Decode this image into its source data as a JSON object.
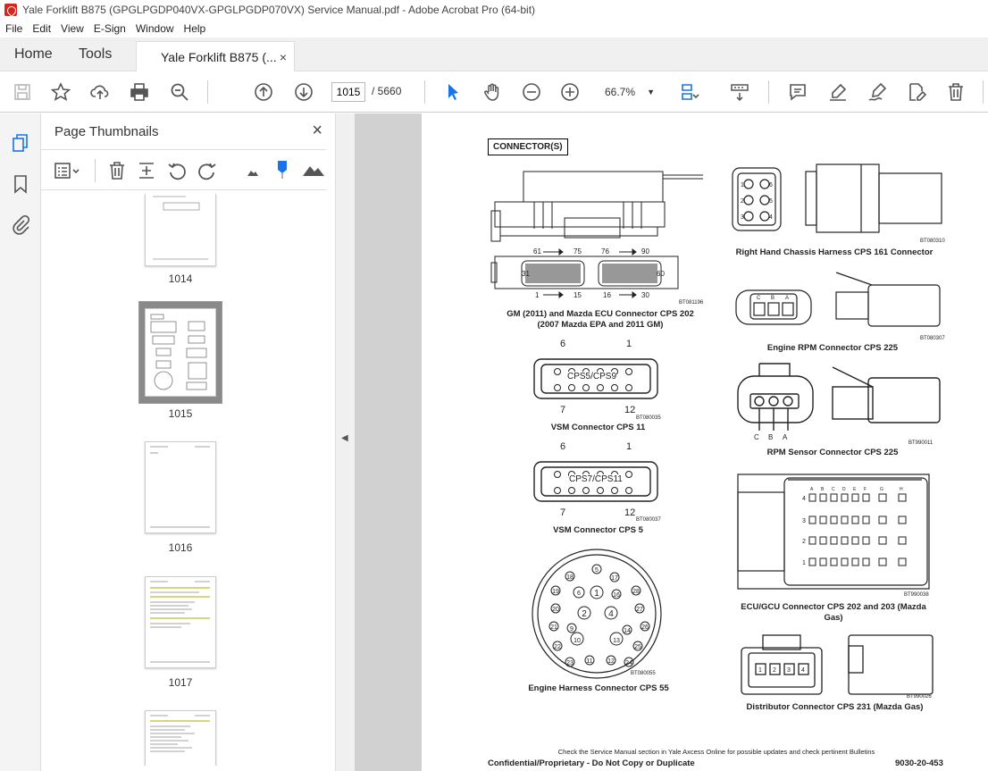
{
  "window": {
    "title": "Yale Forklift B875 (GPGLPGDP040VX-GPGLPGDP070VX) Service Manual.pdf - Adobe Acrobat Pro (64-bit)"
  },
  "menu": [
    "File",
    "Edit",
    "View",
    "E-Sign",
    "Window",
    "Help"
  ],
  "tabs": {
    "home": "Home",
    "tools": "Tools",
    "document": "Yale Forklift B875 (...",
    "close": "×"
  },
  "toolbar": {
    "page_current": "1015",
    "page_total": "/ 5660",
    "zoom": "66.7%"
  },
  "thumbnails": {
    "title": "Page Thumbnails",
    "close": "×",
    "pages": [
      {
        "label": "1014",
        "selected": false
      },
      {
        "label": "1015",
        "selected": true
      },
      {
        "label": "1016",
        "selected": false
      },
      {
        "label": "1017",
        "selected": false
      }
    ]
  },
  "document": {
    "heading": "CONNECTOR(S)",
    "captions": {
      "gm_ecu_line1": "GM (2011) and Mazda ECU Connector CPS 202",
      "gm_ecu_line2": "(2007 Mazda EPA and 2011 GM)",
      "rh_chassis": "Right Hand Chassis Harness CPS 161 Connector",
      "engine_rpm": "Engine RPM Connector CPS 225",
      "vsm11": "VSM Connector CPS 11",
      "rpm_sensor": "RPM Sensor Connector CPS 225",
      "vsm5": "VSM Connector CPS 5",
      "ecu_gcu_line1": "ECU/GCU Connector CPS 202 and 203 (Mazda",
      "ecu_gcu_line2": "Gas)",
      "engine_harness": "Engine Harness Connector CPS 55",
      "distributor": "Distributor Connector CPS 231 (Mazda Gas)"
    },
    "codes": {
      "bt081196": "BT081196",
      "bt080310": "BT080310",
      "bt080307": "BT080307",
      "bt080035": "BT080035",
      "bt990011": "BT990011",
      "bt080037": "BT080037",
      "bt990038": "BT990038",
      "bt080055": "BT080055",
      "bt990026": "BT990026"
    },
    "pin_labels": {
      "ecu_top_left": "61",
      "ecu_top_mid_left": "75",
      "ecu_top_mid_right": "76",
      "ecu_top_right": "90",
      "ecu_left": "31",
      "ecu_right": "60",
      "ecu_bot_left": "1",
      "ecu_bot_mid_left": "15",
      "ecu_bot_mid_right": "16",
      "ecu_bot_right": "30",
      "vsm11_top_left": "6",
      "vsm11_top_right": "1",
      "vsm11_bot_left": "7",
      "vsm11_bot_right": "12",
      "vsm11_name": "CPS5/CPS9",
      "vsm5_top_left": "6",
      "vsm5_top_right": "1",
      "vsm5_bot_left": "7",
      "vsm5_bot_right": "12",
      "vsm5_name": "CPS7/CPS11",
      "rpm_c": "C",
      "rpm_b": "B",
      "rpm_a": "A"
    },
    "footer": {
      "notice": "Check the Service Manual section in Yale Axcess Online for possible updates and check pertinent Bulletins",
      "confidential": "Confidential/Proprietary - Do Not Copy or Duplicate",
      "page_code": "9030-20-453"
    }
  }
}
